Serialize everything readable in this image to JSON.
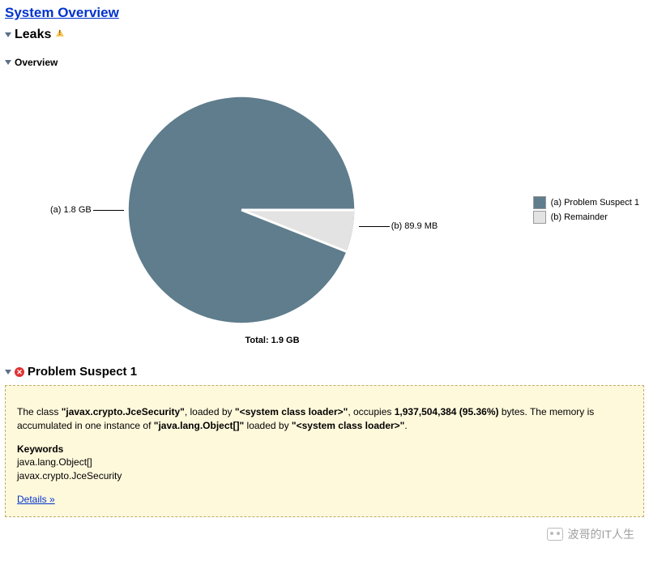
{
  "page_title": "System Overview",
  "leaks": {
    "title": "Leaks",
    "overview_title": "Overview"
  },
  "chart_data": {
    "type": "pie",
    "title": "",
    "total_label": "Total: 1.9 GB",
    "slices": [
      {
        "key": "a",
        "label": "(a) Problem Suspect 1",
        "callout": "(a)  1.8 GB",
        "bytes": 1937504384,
        "percent": 95.36,
        "display_value": "1.8 GB",
        "color": "#5f7d8c"
      },
      {
        "key": "b",
        "label": "(b) Remainder",
        "callout": "(b)  89.9 MB",
        "bytes": 94267392,
        "percent": 4.64,
        "display_value": "89.9 MB",
        "color": "#e3e3e3"
      }
    ],
    "legend_position": "right"
  },
  "problem": {
    "title": "Problem Suspect 1",
    "para1_prefix": "The class ",
    "class_name": "\"javax.crypto.JceSecurity\"",
    "para1_mid1": ", loaded by ",
    "loader": "\"<system class loader>\"",
    "para1_mid2": ", occupies ",
    "size_text": "1,937,504,384 (95.36%)",
    "para1_mid3": " bytes. The memory is accumulated in one instance of ",
    "instance_class": "\"java.lang.Object[]\"",
    "para1_mid4": " loaded by ",
    "loader2": "\"<system class loader>\"",
    "para1_end": ".",
    "keywords_heading": "Keywords",
    "keyword1": "java.lang.Object[]",
    "keyword2": "javax.crypto.JceSecurity",
    "details_link": "Details »"
  },
  "watermark": "波哥的IT人生"
}
